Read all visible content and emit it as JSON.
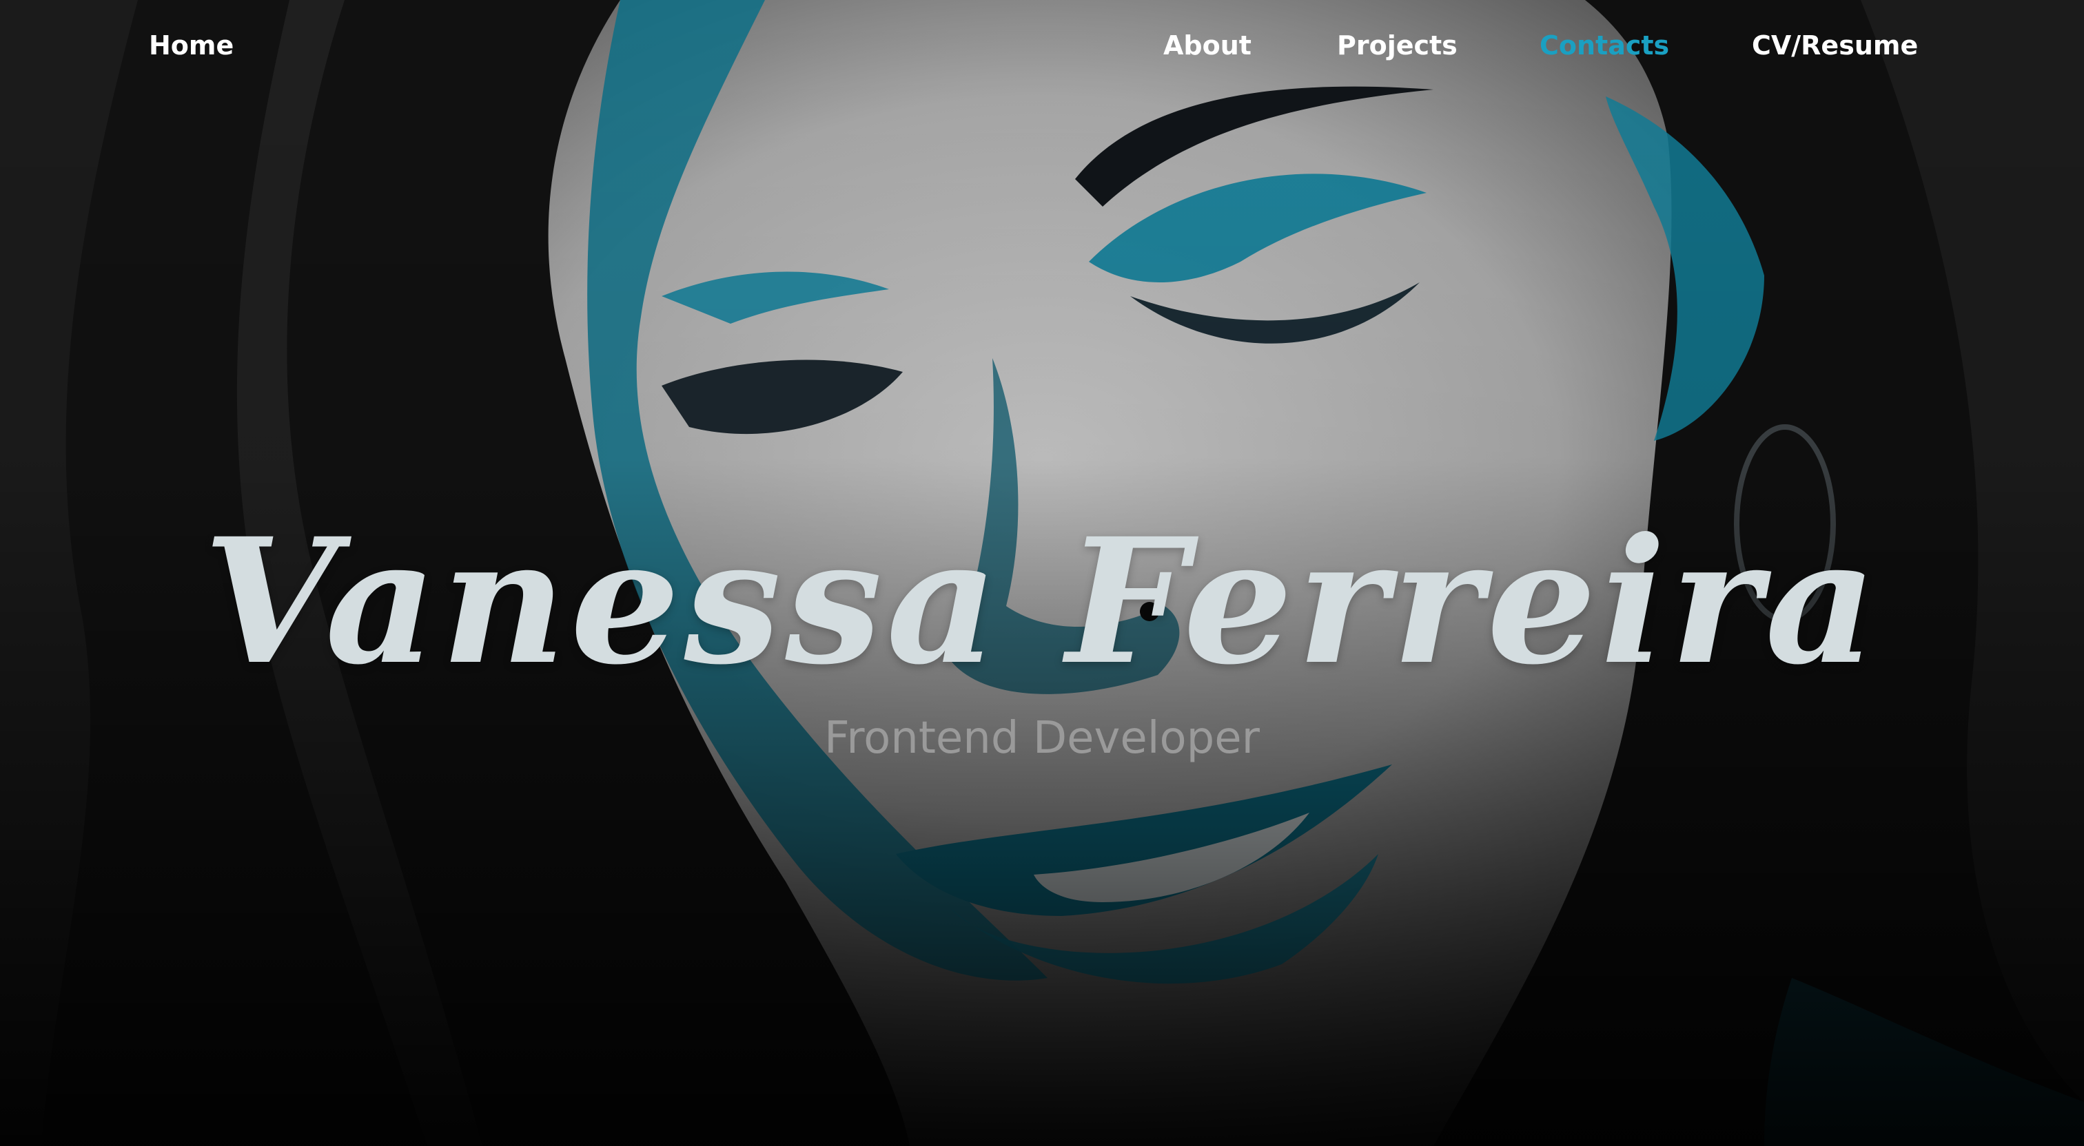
{
  "nav": {
    "home": "Home",
    "items": [
      {
        "label": "About",
        "active": false
      },
      {
        "label": "Projects",
        "active": false
      },
      {
        "label": "Contacts",
        "active": true
      },
      {
        "label": "CV/Resume",
        "active": false
      }
    ]
  },
  "hero": {
    "name": "Vanessa Ferreira",
    "role": "Frontend Developer"
  },
  "colors": {
    "nav_text": "#ffffff",
    "nav_active": "#1aa0c2",
    "accent_teal": "#0f7f9a",
    "hair": "#121212",
    "skin": "#b9b9b9"
  },
  "background": {
    "image": "illustrated-portrait-woman-teal-accents"
  }
}
